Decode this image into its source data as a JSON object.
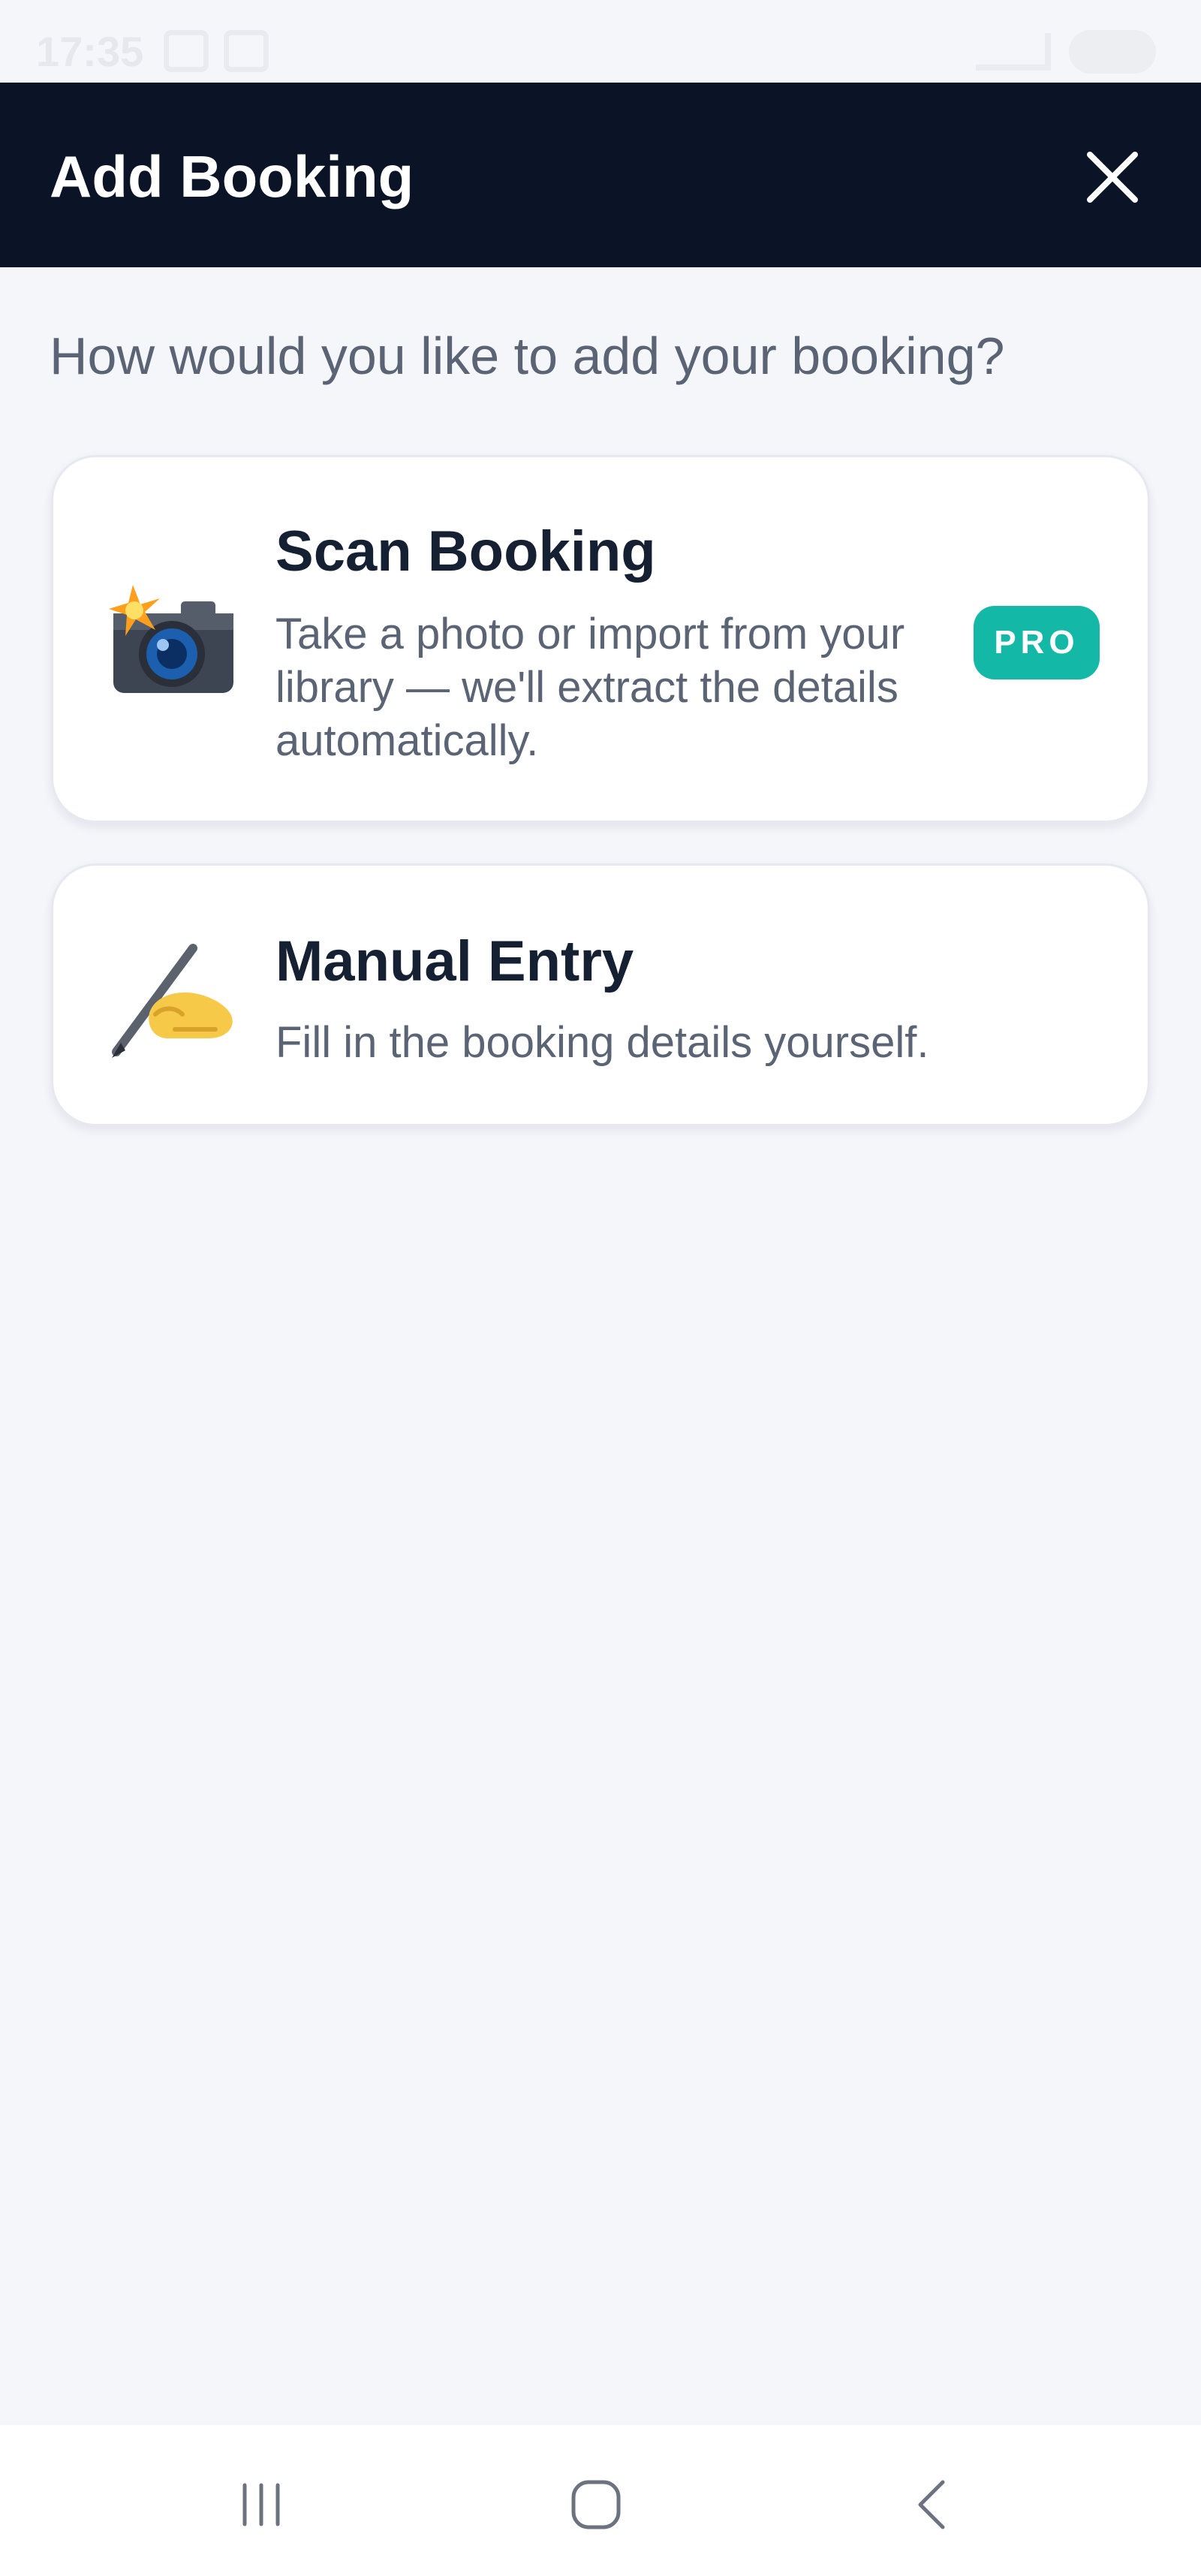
{
  "status_bar": {
    "time": "17:35"
  },
  "header": {
    "title": "Add Booking",
    "close_icon": "close-icon"
  },
  "prompt": "How would you like to add your booking?",
  "options": [
    {
      "title": "Scan Booking",
      "description": "Take a photo or import from your library — we'll extract the details automatically.",
      "badge": "PRO",
      "icon": "camera-with-flash-icon"
    },
    {
      "title": "Manual Entry",
      "description": "Fill in the booking details yourself.",
      "icon": "writing-hand-icon"
    }
  ],
  "colors": {
    "header_bg": "#0b1426",
    "page_bg": "#f4f6fa",
    "badge_bg": "#14b8a6",
    "title_text": "#162033",
    "muted_text": "#5b6474"
  },
  "nav": {
    "recents_icon": "recents-icon",
    "home_icon": "home-icon",
    "back_icon": "back-icon"
  }
}
